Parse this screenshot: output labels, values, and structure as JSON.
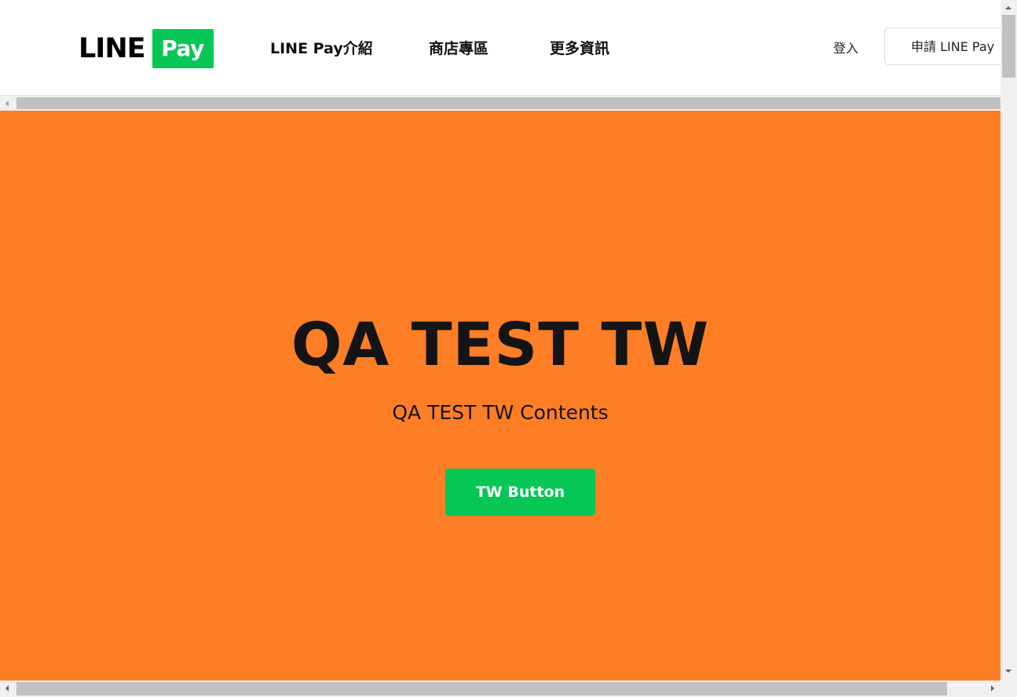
{
  "header": {
    "logo": {
      "line_text": "LINE",
      "pay_text": "Pay"
    },
    "nav": [
      {
        "label": "LINE Pay介紹"
      },
      {
        "label": "商店專區"
      },
      {
        "label": "更多資訊"
      }
    ],
    "login_label": "登入",
    "apply_label": "申請 LINE Pay"
  },
  "hero": {
    "title": "QA TEST TW",
    "subtitle": "QA TEST TW Contents",
    "button_label": "TW Button",
    "background_color": "#fe7e25",
    "button_color": "#06c755"
  },
  "colors": {
    "brand_green": "#06c755",
    "hero_orange": "#fe7e25",
    "text_dark": "#141414"
  },
  "icons": {
    "scroll_up": "arrow-up-icon",
    "scroll_down": "arrow-down-icon",
    "scroll_left": "arrow-left-icon",
    "scroll_right": "arrow-right-icon"
  }
}
